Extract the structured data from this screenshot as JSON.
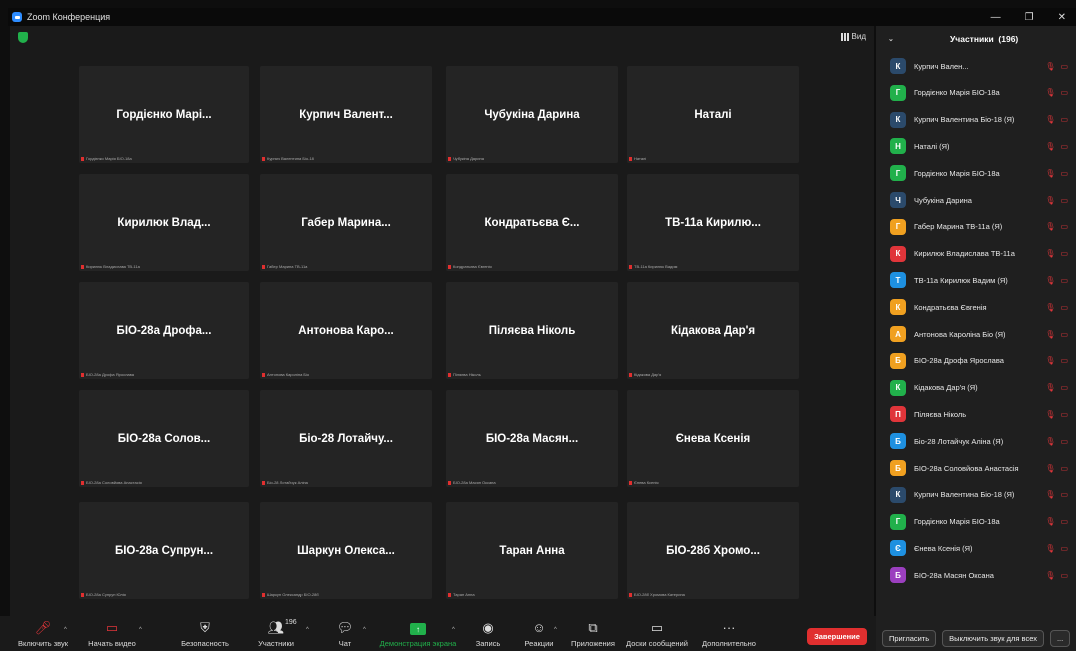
{
  "window": {
    "title": "Zoom Конференция",
    "controls": [
      "—",
      "❐",
      "✕"
    ]
  },
  "view_button": {
    "label": "Вид"
  },
  "tiles": [
    {
      "name": "Гордієнко Марі...",
      "small": "Гордієнко Марія БІО-18а"
    },
    {
      "name": "Курпич Валент...",
      "small": "Курпич Валентина Біо-18"
    },
    {
      "name": "Чубукіна Дарина",
      "small": "Чубукіна Дарина"
    },
    {
      "name": "Наталі",
      "small": "Наталі"
    },
    {
      "name": "Кирилюк Влад...",
      "small": "Кирилюк Владислава ТВ-11а"
    },
    {
      "name": "Габер Марина...",
      "small": "Габер Марина ТВ-11а"
    },
    {
      "name": "Кондратьєва Є...",
      "small": "Кондратьєва Євгенія"
    },
    {
      "name": "ТВ-11а Кирилю...",
      "small": "ТВ-11а Кирилюк Вадим"
    },
    {
      "name": "БІО-28а Дрофа...",
      "small": "БІО-28а Дрофа Ярослава"
    },
    {
      "name": "Антонова Каро...",
      "small": "Антонова Кароліна Біо"
    },
    {
      "name": "Піляєва Ніколь",
      "small": "Піляєва Ніколь"
    },
    {
      "name": "Кідакова Дар'я",
      "small": "Кідакова Дар'я"
    },
    {
      "name": "БІО-28а Солов...",
      "small": "БІО-28а Соловйова Анастасія"
    },
    {
      "name": "Біо-28 Лотайчу...",
      "small": "Біо-28 Лотайчук Аліна"
    },
    {
      "name": "БІО-28а Масян...",
      "small": "БІО-28а Масян Оксана"
    },
    {
      "name": "Єнева Ксенія",
      "small": "Єнева Ксенія"
    },
    {
      "name": "БІО-28а Супрун...",
      "small": "БІО-28а Супрун Юлія"
    },
    {
      "name": "Шаркун Олекса...",
      "small": "Шаркун Олександр БІО-28б"
    },
    {
      "name": "Таран Анна",
      "small": "Таран Анна"
    },
    {
      "name": "БІО-28б Хромо...",
      "small": "БІО-28б Хромова Катерина"
    }
  ],
  "sidebar": {
    "title": "Участники",
    "count": "(196)",
    "participants": [
      {
        "initial": "К",
        "name": "Курпич Вален...",
        "color": "#2b4a6b"
      },
      {
        "initial": "Г",
        "name": "Гордієнко Марія БІО-18а",
        "color": "#21b04b"
      },
      {
        "initial": "К",
        "name": "Курпич Валентина Біо-18 (Я)",
        "color": "#2b4a6b"
      },
      {
        "initial": "Н",
        "name": "Наталі (Я)",
        "color": "#21b04b"
      },
      {
        "initial": "Г",
        "name": "Гордієнко Марія БІО-18а",
        "color": "#21b04b"
      },
      {
        "initial": "Ч",
        "name": "Чубукіна Дарина",
        "color": "#2b4a6b"
      },
      {
        "initial": "Г",
        "name": "Габер Марина ТВ-11а (Я)",
        "color": "#f0a020"
      },
      {
        "initial": "К",
        "name": "Кирилюк Владислава ТВ-11а",
        "color": "#e0353a"
      },
      {
        "initial": "Т",
        "name": "ТВ-11а Кирилюк Вадим (Я)",
        "color": "#1e90e0"
      },
      {
        "initial": "К",
        "name": "Кондратьєва Євгенія",
        "color": "#f0a020"
      },
      {
        "initial": "А",
        "name": "Антонова Кароліна Біо (Я)",
        "color": "#f0a020"
      },
      {
        "initial": "Б",
        "name": "БІО-28а Дрофа Ярослава",
        "color": "#f0a020"
      },
      {
        "initial": "К",
        "name": "Кідакова Дар'я (Я)",
        "color": "#21b04b"
      },
      {
        "initial": "П",
        "name": "Піляєва Ніколь",
        "color": "#e0353a"
      },
      {
        "initial": "Б",
        "name": "Біо-28 Лотайчук Аліна (Я)",
        "color": "#1e90e0"
      },
      {
        "initial": "Б",
        "name": "БІО-28а Соловйова Анастасія",
        "color": "#f0a020"
      },
      {
        "initial": "К",
        "name": "Курпич Валентина Біо-18 (Я)",
        "color": "#2b4a6b"
      },
      {
        "initial": "Г",
        "name": "Гордієнко Марія БІО-18а",
        "color": "#21b04b"
      },
      {
        "initial": "Є",
        "name": "Єнева Ксенія (Я)",
        "color": "#1e90e0"
      },
      {
        "initial": "Б",
        "name": "БІО-28а Масян Оксана",
        "color": "#9b3fbf"
      }
    ],
    "invite_label": "Пригласить",
    "mute_all_label": "Выключить звук для всех",
    "more_label": "..."
  },
  "toolbar": {
    "mute_label": "Включить звук",
    "video_label": "Начать видео",
    "security_label": "Безопасность",
    "participants_label": "Участники",
    "participants_count": "196",
    "chat_label": "Чат",
    "share_label": "Демонстрация экрана",
    "record_label": "Запись",
    "reactions_label": "Реакции",
    "apps_label": "Приложения",
    "whiteboard_label": "Доски сообщений",
    "more_label": "Дополнительно",
    "end_label": "Завершение"
  }
}
